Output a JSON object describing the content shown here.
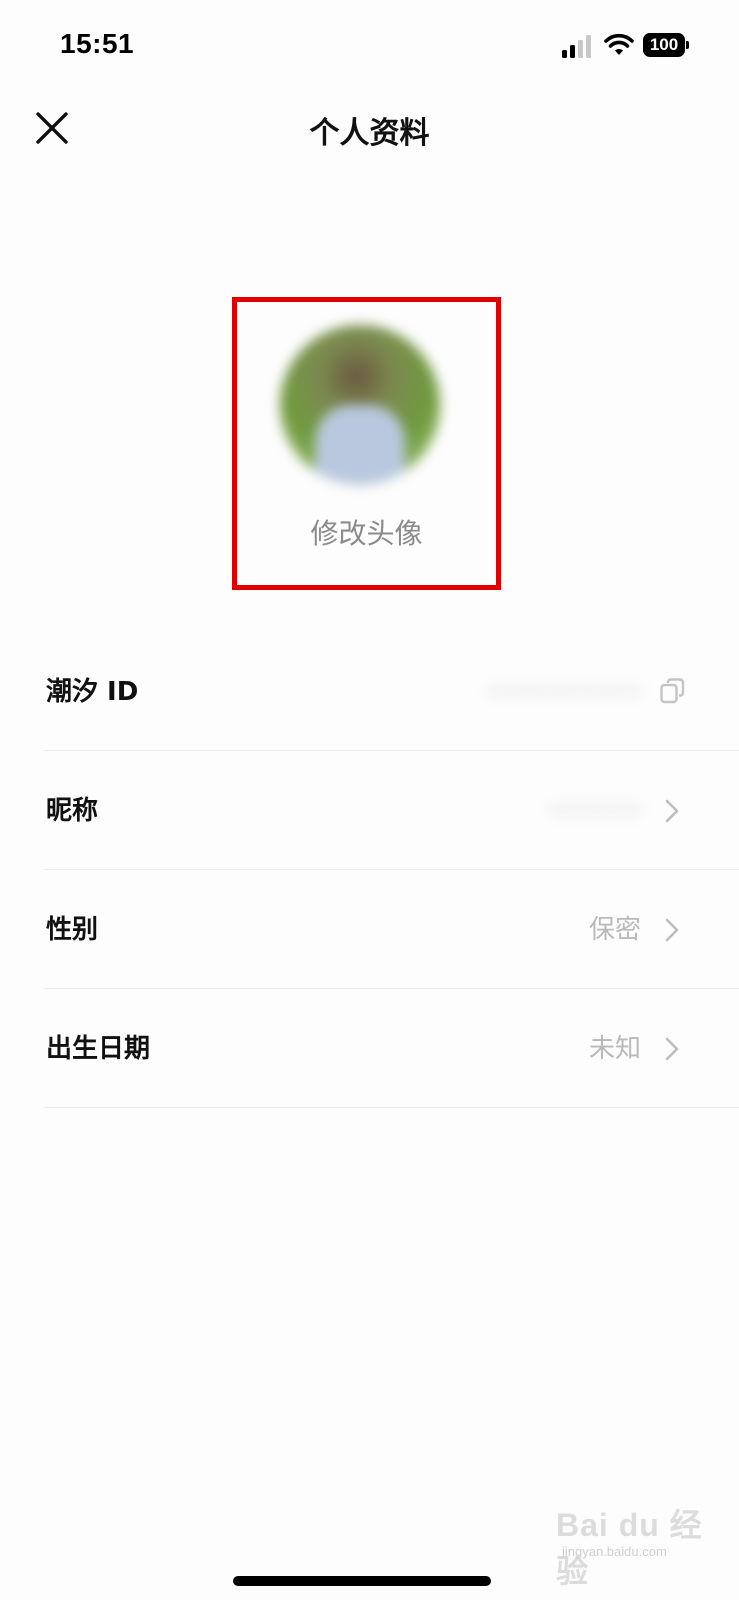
{
  "status_bar": {
    "time": "15:51",
    "battery": "100",
    "icons": [
      "signal-icon",
      "wifi-icon",
      "battery-icon"
    ]
  },
  "header": {
    "title": "个人资料",
    "close_icon": "close-icon"
  },
  "avatar": {
    "change_label": "修改头像",
    "highlight_color": "#e10000"
  },
  "profile_rows": [
    {
      "label": "潮汐 ID",
      "value": "••••••••••",
      "value_blurred": true,
      "action_icon": "copy-icon"
    },
    {
      "label": "昵称",
      "value": "••••••",
      "value_blurred": true,
      "action_icon": "chevron-right-icon"
    },
    {
      "label": "性别",
      "value": "保密",
      "value_blurred": false,
      "action_icon": "chevron-right-icon"
    },
    {
      "label": "出生日期",
      "value": "未知",
      "value_blurred": false,
      "action_icon": "chevron-right-icon"
    }
  ],
  "watermark": {
    "text": "Bai du 经验",
    "sub": "jingyan.baidu.com"
  },
  "colors": {
    "background": "#fdfdfd",
    "label_text": "#111111",
    "secondary_text": "#b9b9b9",
    "divider": "#ececec"
  }
}
